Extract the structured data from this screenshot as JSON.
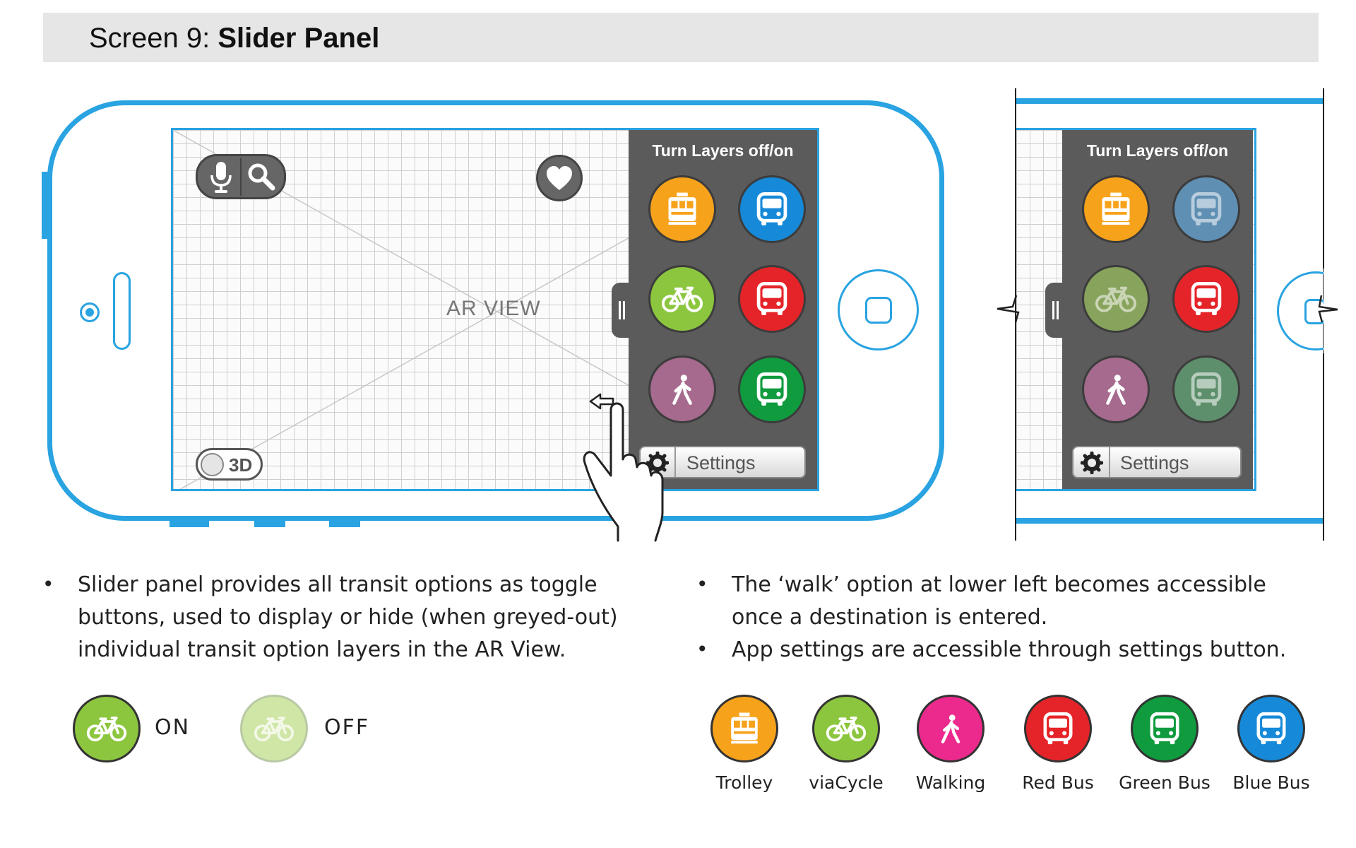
{
  "header": {
    "screen_prefix": "Screen 9: ",
    "screen_name": "Slider Panel"
  },
  "ar_view": {
    "label": "AR VIEW",
    "toggle_3d_label": "3D"
  },
  "panel": {
    "title": "Turn Layers off/on",
    "settings_label": "Settings"
  },
  "layers_main": [
    {
      "name": "Trolley",
      "state": "on",
      "icon": "trolley-icon",
      "color": "#f7a21b"
    },
    {
      "name": "Blue Bus",
      "state": "on",
      "icon": "bus-icon",
      "color": "#1689d8"
    },
    {
      "name": "viaCycle",
      "state": "on",
      "icon": "bicycle-icon",
      "color": "#8cc63f"
    },
    {
      "name": "Red Bus",
      "state": "on",
      "icon": "bus-icon",
      "color": "#e52429"
    },
    {
      "name": "Walking",
      "state": "off",
      "icon": "walking-icon",
      "color": "#a56a8d"
    },
    {
      "name": "Green Bus",
      "state": "on",
      "icon": "bus-icon",
      "color": "#0f9b3e"
    }
  ],
  "layers_secondary": [
    {
      "name": "Trolley",
      "state": "on",
      "color": "#f7a21b"
    },
    {
      "name": "Blue Bus",
      "state": "off",
      "color": "#5f8fb2"
    },
    {
      "name": "viaCycle",
      "state": "off",
      "color": "#87a35c"
    },
    {
      "name": "Red Bus",
      "state": "on",
      "color": "#e52429"
    },
    {
      "name": "Walking",
      "state": "off",
      "color": "#a56a8d"
    },
    {
      "name": "Green Bus",
      "state": "off",
      "color": "#5e8f6c"
    }
  ],
  "notes": {
    "left": "Slider panel provides all transit options as toggle buttons, used to display or hide (when greyed-out) individual transit option layers in the AR View.",
    "left_lines": [
      "Slider panel provides all transit options as toggle",
      "buttons, used to display or hide (when greyed-out)",
      "individual transit option layers in the AR View."
    ],
    "right_1_lines": [
      "The ‘walk’ option at lower left becomes accessible",
      "once a destination is entered."
    ],
    "right_2": "App settings are accessible through settings button."
  },
  "state_legend": {
    "on_label": "ON",
    "off_label": "OFF",
    "on_color": "#8cc63f",
    "off_color": "#cfe6a6"
  },
  "transit_legend": [
    {
      "label": "Trolley",
      "color": "#f7a21b",
      "icon": "trolley-icon"
    },
    {
      "label": "viaCycle",
      "color": "#8cc63f",
      "icon": "bicycle-icon"
    },
    {
      "label": "Walking",
      "color": "#ec2a8d",
      "icon": "walking-icon"
    },
    {
      "label": "Red Bus",
      "color": "#e52429",
      "icon": "bus-icon"
    },
    {
      "label": "Green Bus",
      "color": "#0f9b3e",
      "icon": "bus-icon"
    },
    {
      "label": "Blue Bus",
      "color": "#1689d8",
      "icon": "bus-icon"
    }
  ],
  "colors": {
    "device_blue": "#29a3e1",
    "panel_gray": "#5b5b5b"
  }
}
